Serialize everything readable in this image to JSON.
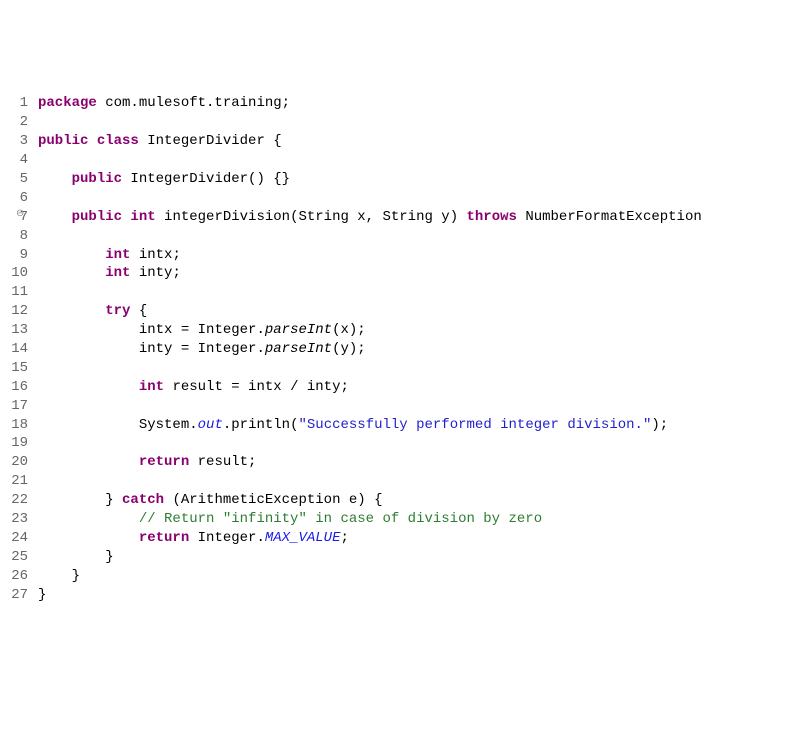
{
  "lines": {
    "count": 27,
    "fold_at": 7
  },
  "code": {
    "l1_pkg": "package",
    "l1_ns": " com.mulesoft.training;",
    "l3_pub": "public",
    "l3_class": " class",
    "l3_name": " IntegerDivider {",
    "l5_pub": "public",
    "l5_ctor": " IntegerDivider() {}",
    "l7_pub": "public",
    "l7_int": " int",
    "l7_sig": " integerDivision(String x, String y) ",
    "l7_throws": "throws",
    "l7_ex": " NumberFormatException",
    "l9_int": "int",
    "l9_rest": " intx;",
    "l10_int": "int",
    "l10_rest": " inty;",
    "l12_try": "try",
    "l12_rest": " {",
    "l13_a": "intx = Integer.",
    "l13_m": "parseInt",
    "l13_b": "(x);",
    "l14_a": "inty = Integer.",
    "l14_m": "parseInt",
    "l14_b": "(y);",
    "l16_int": "int",
    "l16_rest": " result = intx / inty;",
    "l17_a": "System.",
    "l17_out": "out",
    "l17_b": ".println(",
    "l17_str": "\"Successfully performed integer division.\"",
    "l17_c": ");",
    "l19_ret": "return",
    "l19_rest": " result;",
    "l22_a": "} ",
    "l22_catch": "catch",
    "l22_b": " (ArithmeticException e) {",
    "l23_com": "// Return \"infinity\" in case of division by zero",
    "l24_ret": "return",
    "l24_a": " Integer.",
    "l24_max": "MAX_VALUE",
    "l24_b": ";",
    "l25": "}",
    "l26": "}",
    "l27": "}"
  }
}
